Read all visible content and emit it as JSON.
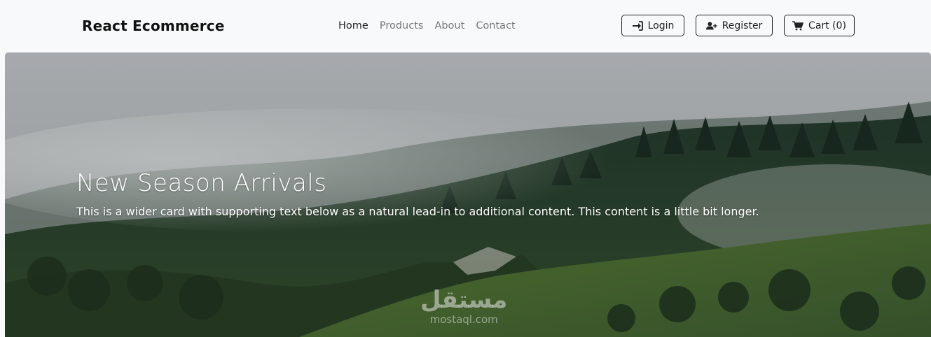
{
  "navbar": {
    "brand": "React Ecommerce",
    "links": [
      {
        "label": "Home",
        "active": true
      },
      {
        "label": "Products",
        "active": false
      },
      {
        "label": "About",
        "active": false
      },
      {
        "label": "Contact",
        "active": false
      }
    ],
    "buttons": {
      "login": {
        "label": "Login",
        "icon": "sign-in-icon"
      },
      "register": {
        "label": "Register",
        "icon": "user-plus-icon"
      },
      "cart": {
        "label": "Cart (0)",
        "icon": "shopping-cart-icon"
      }
    }
  },
  "hero": {
    "title": "New Season Arrivals",
    "text": "This is a wider card with supporting text below as a natural lead-in to additional content. This content is a little bit longer.",
    "image": "misty-forest-hills"
  },
  "watermark": {
    "arabic": "مستقل",
    "latin": "mostaql.com"
  }
}
